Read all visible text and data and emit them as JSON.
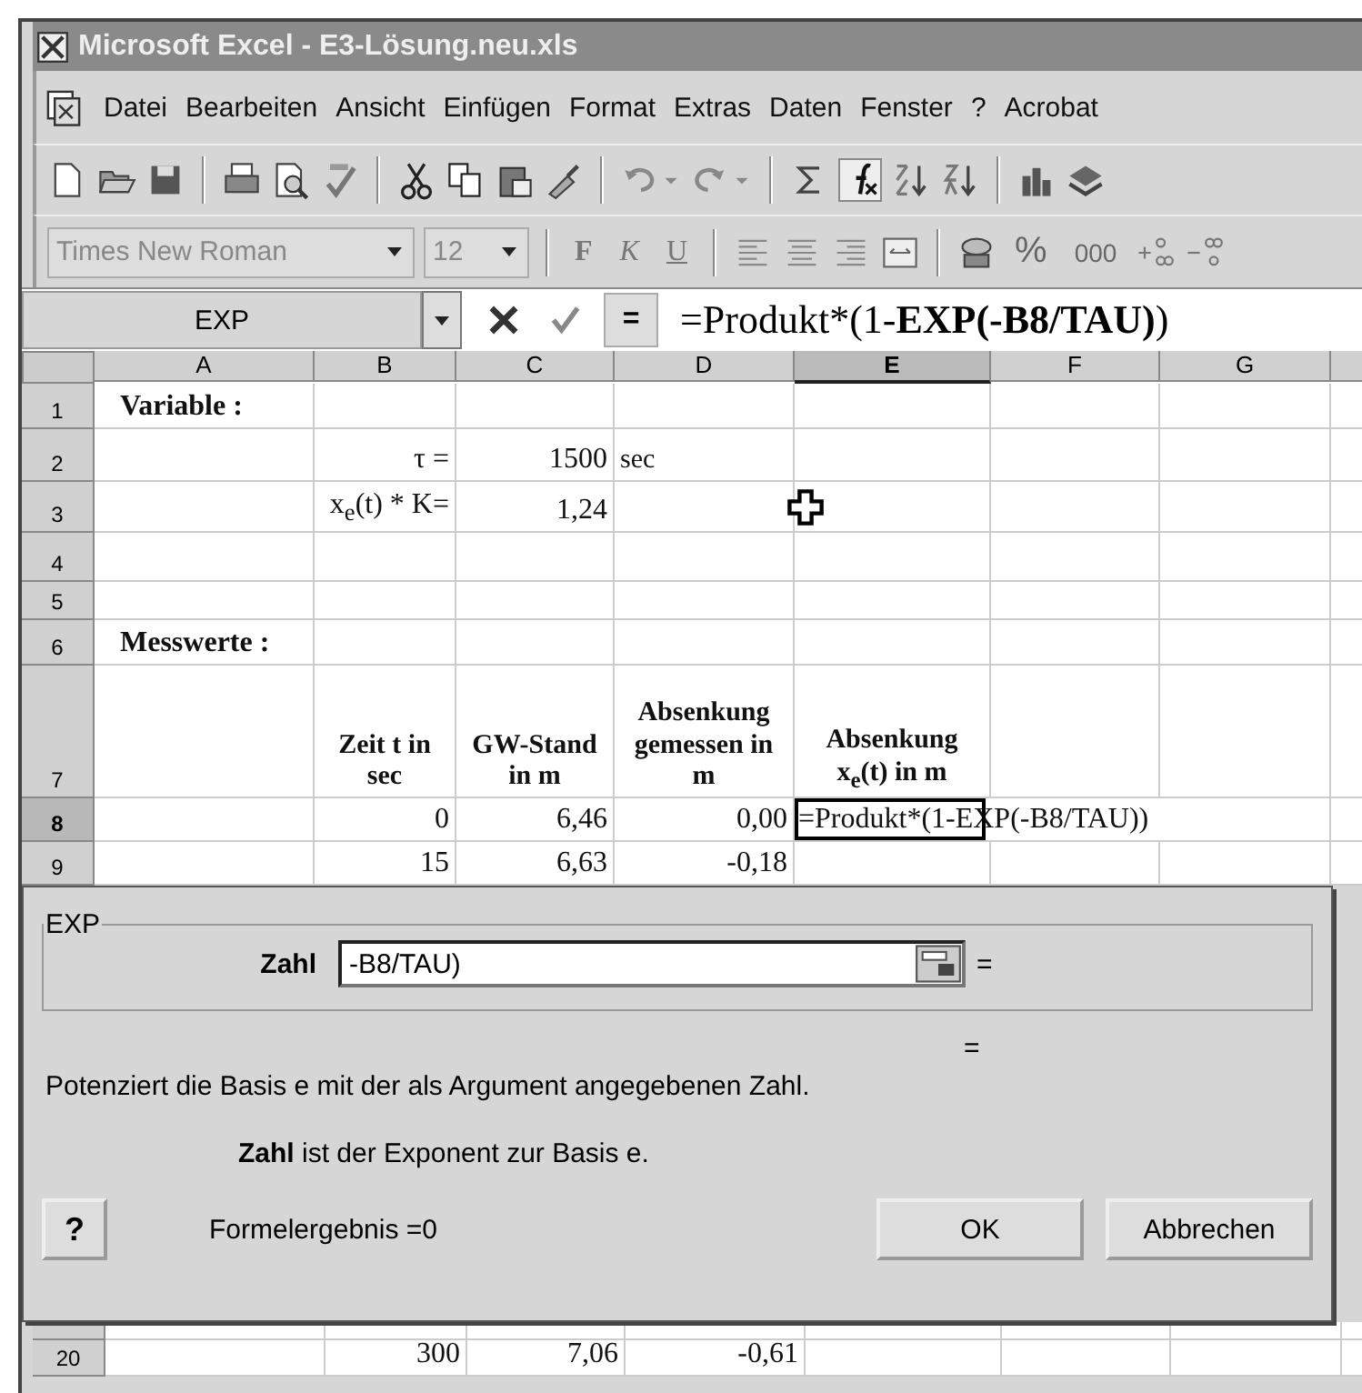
{
  "window": {
    "title": "Microsoft Excel - E3-Lösung.neu.xls"
  },
  "menu": [
    {
      "label": "Datei"
    },
    {
      "label": "Bearbeiten"
    },
    {
      "label": "Ansicht"
    },
    {
      "label": "Einfügen"
    },
    {
      "label": "Format"
    },
    {
      "label": "Extras"
    },
    {
      "label": "Daten"
    },
    {
      "label": "Fenster"
    },
    {
      "label": "?"
    },
    {
      "label": "Acrobat"
    }
  ],
  "format_bar": {
    "font": "Times New Roman",
    "size": "12",
    "styles": [
      "F",
      "K",
      "U"
    ],
    "percent": "%",
    "thousands": "000"
  },
  "formula_bar": {
    "name_box": "EXP",
    "equals": "=",
    "formula": "=Produkt*(1-**EXP(-B8/TAU)**)"
  },
  "sheet": {
    "columns": [
      {
        "label": "A",
        "selected": false
      },
      {
        "label": "B",
        "selected": false
      },
      {
        "label": "C",
        "selected": false
      },
      {
        "label": "D",
        "selected": false
      },
      {
        "label": "E",
        "selected": true
      },
      {
        "label": "F",
        "selected": false
      },
      {
        "label": "G",
        "selected": false
      }
    ],
    "rows": [
      {
        "number": "1",
        "selected": false,
        "cells": [
          {
            "kind": "label",
            "text": "Variable :"
          },
          null,
          null,
          null,
          null,
          null,
          null
        ]
      },
      {
        "number": "2",
        "selected": false,
        "cells": [
          null,
          {
            "kind": "number",
            "text": "τ ="
          },
          {
            "kind": "number",
            "text": "1500"
          },
          {
            "kind": "text",
            "text": "sec"
          },
          null,
          null,
          null
        ]
      },
      {
        "number": "3",
        "selected": false,
        "cells": [
          null,
          {
            "kind": "number",
            "text": "x$_{e}$(t) * K="
          },
          {
            "kind": "number",
            "text": "1,24"
          },
          null,
          null,
          null,
          null
        ]
      },
      {
        "number": "4",
        "selected": false,
        "cells": [
          null,
          null,
          null,
          null,
          null,
          null,
          null
        ]
      },
      {
        "number": "5",
        "selected": false,
        "cells": [
          null,
          null,
          null,
          null,
          null,
          null,
          null
        ]
      },
      {
        "number": "6",
        "selected": false,
        "cells": [
          {
            "kind": "label",
            "text": "Messwerte :"
          },
          null,
          null,
          null,
          null,
          null,
          null
        ]
      },
      {
        "number": "7",
        "selected": false,
        "cells": [
          null,
          {
            "kind": "heading",
            "text": "Zeit t in sec"
          },
          {
            "kind": "heading",
            "text": "GW-Stand in m"
          },
          {
            "kind": "heading",
            "text": "Absenkung gemessen in m"
          },
          {
            "kind": "heading",
            "text": "Absenkung x$_{e}$(t) in m"
          },
          null,
          null
        ]
      },
      {
        "number": "8",
        "selected": true,
        "cells": [
          null,
          {
            "kind": "number",
            "text": "0"
          },
          {
            "kind": "number",
            "text": "6,46"
          },
          {
            "kind": "number",
            "text": "0,00"
          },
          {
            "kind": "formula",
            "text": "=Produkt*(1-EXP(-B8/TAU))"
          },
          null,
          null
        ]
      },
      {
        "number": "9",
        "selected": false,
        "cells": [
          null,
          {
            "kind": "number",
            "text": "15"
          },
          {
            "kind": "number",
            "text": "6,63"
          },
          {
            "kind": "number",
            "text": "-0,18"
          },
          null,
          null,
          null
        ]
      }
    ],
    "rows_below": [
      {
        "number": "20",
        "selected": false,
        "cells": [
          null,
          {
            "kind": "number",
            "text": "300"
          },
          {
            "kind": "number",
            "text": "7,06"
          },
          {
            "kind": "number",
            "text": "-0,61"
          },
          null,
          null,
          null
        ]
      }
    ]
  },
  "dialog": {
    "function": "EXP",
    "argument_label": "Zahl",
    "argument_value": "-B8/TAU)",
    "argument_result": "=",
    "function_result": "=",
    "description": "Potenziert die Basis e mit der als Argument angegebenen Zahl.",
    "argument_help": "**Zahl** ist der Exponent zur Basis e.",
    "help_button": "?",
    "formula_result": "Formelergebnis =0",
    "buttons": [
      "OK",
      "Abbrechen"
    ]
  }
}
